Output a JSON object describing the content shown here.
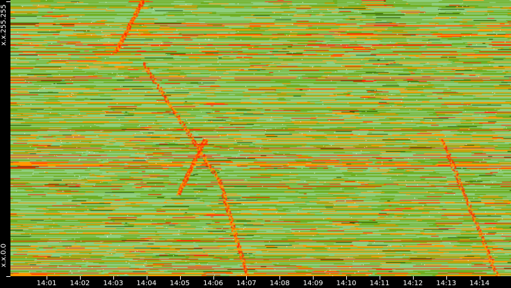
{
  "chart_data": {
    "type": "heatmap",
    "title": "",
    "xlabel": "",
    "ylabel": "",
    "x_ticks": [
      "14:01",
      "14:02",
      "14:03",
      "14:04",
      "14:05",
      "14:06",
      "14:07",
      "14:08",
      "14:09",
      "14:10",
      "14:11",
      "14:12",
      "14:13",
      "14:14"
    ],
    "y_ticks": [
      "x.x.255.255",
      "x.x.0.0"
    ],
    "x_range": [
      "14:00",
      "14:15"
    ],
    "y_range": [
      "x.x.0.0",
      "x.x.255.255"
    ],
    "colors": {
      "low": "#8fcf7f",
      "mid": "#6fae1f",
      "high": "#ff9900",
      "max": "#ff2a00",
      "empty": "#ffffff"
    }
  }
}
